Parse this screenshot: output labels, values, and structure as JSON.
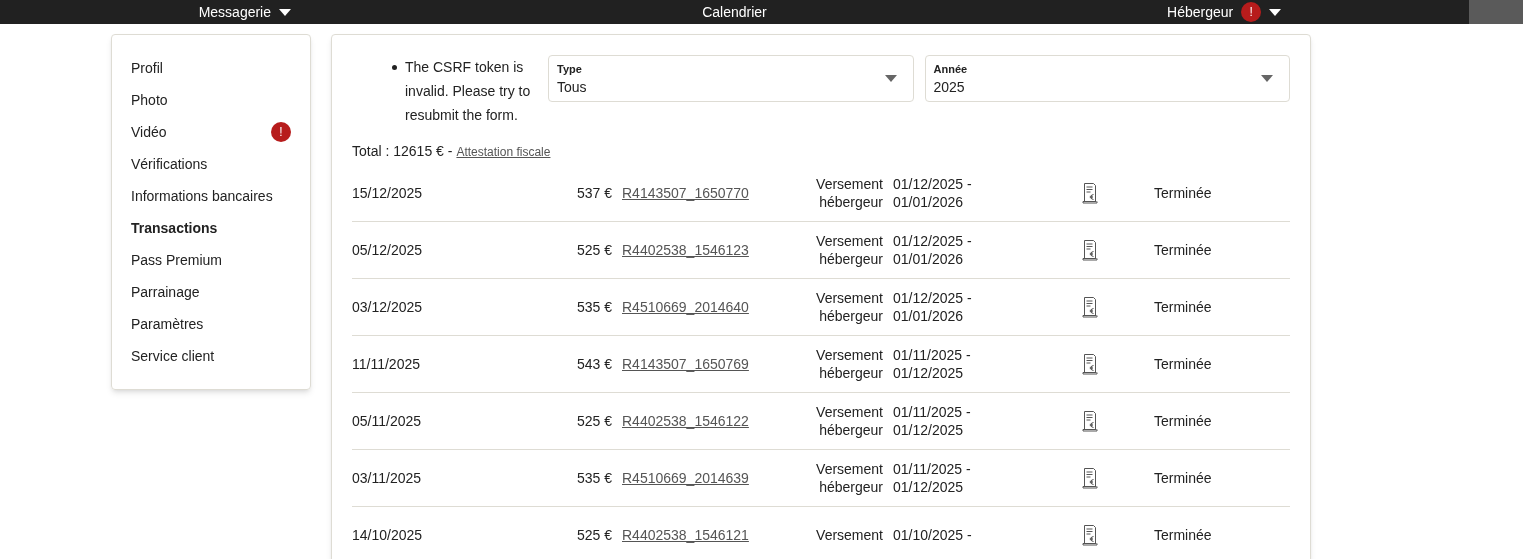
{
  "navbar": {
    "items": [
      {
        "label": "Messagerie",
        "dropdown": true
      },
      {
        "label": "Calendrier",
        "dropdown": false
      },
      {
        "label": "Hébergeur",
        "dropdown": true,
        "alert": "!"
      }
    ]
  },
  "sidebar": {
    "items": [
      {
        "label": "Profil",
        "selected": false
      },
      {
        "label": "Photo",
        "selected": false
      },
      {
        "label": "Vidéo",
        "selected": false,
        "alert": "!"
      },
      {
        "label": "Vérifications",
        "selected": false
      },
      {
        "label": "Informations bancaires",
        "selected": false
      },
      {
        "label": "Transactions",
        "selected": true
      },
      {
        "label": "Pass Premium",
        "selected": false
      },
      {
        "label": "Parrainage",
        "selected": false
      },
      {
        "label": "Paramètres",
        "selected": false
      },
      {
        "label": "Service client",
        "selected": false
      }
    ]
  },
  "errors": [
    "The CSRF token is invalid. Please try to resubmit the form."
  ],
  "filters": [
    {
      "label": "Type",
      "value": "Tous"
    },
    {
      "label": "Année",
      "value": "2025"
    }
  ],
  "total": {
    "text": "Total : 12615 € -",
    "link": "Attestation fiscale"
  },
  "transactions": [
    {
      "date": "15/12/2025",
      "amount": "537 €",
      "reference": "R4143507_1650770",
      "type": [
        "Versement",
        "hébergeur"
      ],
      "period": [
        "01/12/2025 -",
        "01/01/2026"
      ],
      "status": "Terminée"
    },
    {
      "date": "05/12/2025",
      "amount": "525 €",
      "reference": "R4402538_1546123",
      "type": [
        "Versement",
        "hébergeur"
      ],
      "period": [
        "01/12/2025 -",
        "01/01/2026"
      ],
      "status": "Terminée"
    },
    {
      "date": "03/12/2025",
      "amount": "535 €",
      "reference": "R4510669_2014640",
      "type": [
        "Versement",
        "hébergeur"
      ],
      "period": [
        "01/12/2025 -",
        "01/01/2026"
      ],
      "status": "Terminée"
    },
    {
      "date": "11/11/2025",
      "amount": "543 €",
      "reference": "R4143507_1650769",
      "type": [
        "Versement",
        "hébergeur"
      ],
      "period": [
        "01/11/2025 -",
        "01/12/2025"
      ],
      "status": "Terminée"
    },
    {
      "date": "05/11/2025",
      "amount": "525 €",
      "reference": "R4402538_1546122",
      "type": [
        "Versement",
        "hébergeur"
      ],
      "period": [
        "01/11/2025 -",
        "01/12/2025"
      ],
      "status": "Terminée"
    },
    {
      "date": "03/11/2025",
      "amount": "535 €",
      "reference": "R4510669_2014639",
      "type": [
        "Versement",
        "hébergeur"
      ],
      "period": [
        "01/11/2025 -",
        "01/12/2025"
      ],
      "status": "Terminée"
    },
    {
      "date": "14/10/2025",
      "amount": "525 €",
      "reference": "R4402538_1546121",
      "type": [
        "Versement"
      ],
      "period": [
        "01/10/2025 -"
      ],
      "status": "Terminée"
    }
  ]
}
